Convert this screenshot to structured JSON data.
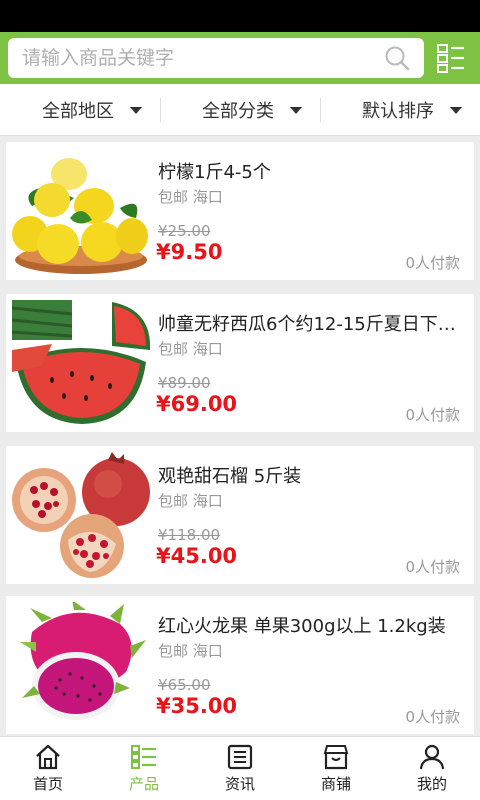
{
  "search": {
    "placeholder": "请输入商品关键字"
  },
  "filters": [
    {
      "label": "全部地区"
    },
    {
      "label": "全部分类"
    },
    {
      "label": "默认排序"
    }
  ],
  "products": [
    {
      "title": "柠檬1斤4-5个",
      "sub": "包邮 海口",
      "old_price": "¥25.00",
      "price": "¥9.50",
      "paid": "0人付款",
      "image": "lemon"
    },
    {
      "title": "帅童无籽西瓜6个约12-15斤夏日下…",
      "sub": "包邮 海口",
      "old_price": "¥89.00",
      "price": "¥69.00",
      "paid": "0人付款",
      "image": "watermelon"
    },
    {
      "title": "观艳甜石榴 5斤装",
      "sub": "包邮 海口",
      "old_price": "¥118.00",
      "price": "¥45.00",
      "paid": "0人付款",
      "image": "pomegranate"
    },
    {
      "title": "红心火龙果 单果300g以上 1.2kg装",
      "sub": "包邮 海口",
      "old_price": "¥65.00",
      "price": "¥35.00",
      "paid": "0人付款",
      "image": "dragonfruit"
    }
  ],
  "tabs": [
    {
      "label": "首页",
      "icon": "home-icon"
    },
    {
      "label": "产品",
      "icon": "list-icon"
    },
    {
      "label": "资讯",
      "icon": "news-icon"
    },
    {
      "label": "商铺",
      "icon": "shop-icon"
    },
    {
      "label": "我的",
      "icon": "user-icon"
    }
  ],
  "active_tab": 1,
  "colors": {
    "accent": "#7dc242",
    "price": "#e8141a"
  }
}
